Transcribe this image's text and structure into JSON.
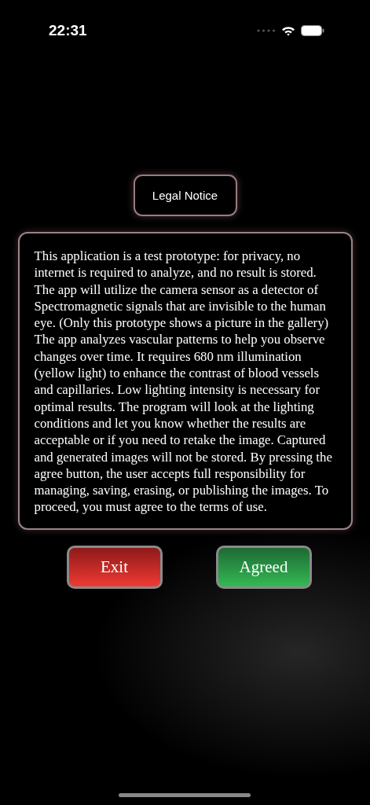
{
  "status_bar": {
    "time": "22:31"
  },
  "title": "Legal Notice",
  "notice": "This application is a test prototype: for privacy, no internet is required to analyze, and no result is stored. The app will utilize the camera sensor as a detector of Spectromagnetic signals that are invisible to the human eye. (Only this prototype shows a picture in the gallery) The app analyzes vascular patterns to help you observe changes over time. It requires 680 nm illumination (yellow light) to enhance the contrast of blood vessels and capillaries. Low lighting intensity is necessary for optimal results. The program will look at the lighting conditions and let you know whether the results are acceptable or if you need to retake the image. Captured and generated images will not be stored. By pressing the agree button, the user accepts full responsibility for managing, saving, erasing, or publishing the images. To proceed, you must agree to the terms of use.",
  "buttons": [
    {
      "label": "Exit",
      "kind": "exit"
    },
    {
      "label": "Agreed",
      "kind": "agree"
    }
  ]
}
